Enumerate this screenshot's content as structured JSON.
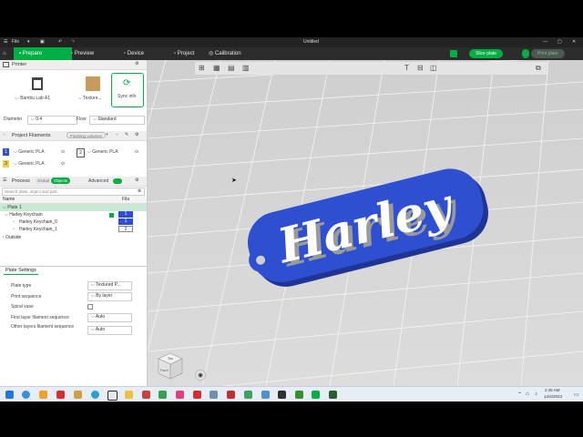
{
  "titlebar": {
    "file_menu": "File",
    "title": "Untitled"
  },
  "tabs": [
    {
      "label": "Prepare"
    },
    {
      "label": "Preview"
    },
    {
      "label": "Device"
    },
    {
      "label": "Project"
    },
    {
      "label": "Calibration"
    }
  ],
  "actions": {
    "slice": "Slice plate",
    "print": "Print plate"
  },
  "printer": {
    "section_title": "Printer",
    "name": "Bambu Lab A1",
    "plate": "Texture...",
    "sync": "Sync info",
    "diameter_label": "Diameter",
    "diameter_value": "0.4",
    "flow_label": "Flow",
    "flow_value": "Standard"
  },
  "filaments": {
    "section_title": "Project Filaments",
    "flushing": "Flushing volumes",
    "items": [
      {
        "num": "1",
        "name": "Generic PLA",
        "color": "#2d4fd0"
      },
      {
        "num": "2",
        "name": "Generic PLA",
        "color": "#ffffff"
      },
      {
        "num": "3",
        "name": "Generic PLA",
        "color": "#e8d34a"
      }
    ]
  },
  "process": {
    "section_title": "Process",
    "toggle_global": "Global",
    "toggle_objects": "Objects",
    "advanced": "Advanced",
    "search_placeholder": "Search plate, object and part.",
    "col_name": "Name",
    "col_fila": "Fila"
  },
  "tree": {
    "plate": "Plate 1",
    "object": "Harley Keychain",
    "object_fila": "1",
    "parts": [
      {
        "name": "Harley Keychain_0",
        "fila": "1"
      },
      {
        "name": "Harley Keychain_1",
        "fila": "2"
      }
    ],
    "outside": "Outside"
  },
  "plate_settings": {
    "section_title": "Plate Settings",
    "plate_type_label": "Plate type",
    "plate_type_value": "Textured P...",
    "print_sequence_label": "Print sequence",
    "print_sequence_value": "By layer",
    "spiral_vase_label": "Spiral vase",
    "first_layer_label": "First layer filament sequence",
    "first_layer_value": "Auto",
    "other_layers_label": "Other layers filament sequence",
    "other_layers_value": "Auto"
  },
  "model_text": "Harley",
  "view_cube": {
    "top": "Top",
    "front": "Front"
  },
  "clock": {
    "time": "2:45 AM",
    "date": "12/4/2023"
  },
  "colors": {
    "accent": "#00ae42",
    "model_blue": "#2d4fd0",
    "model_white": "#ffffff"
  }
}
